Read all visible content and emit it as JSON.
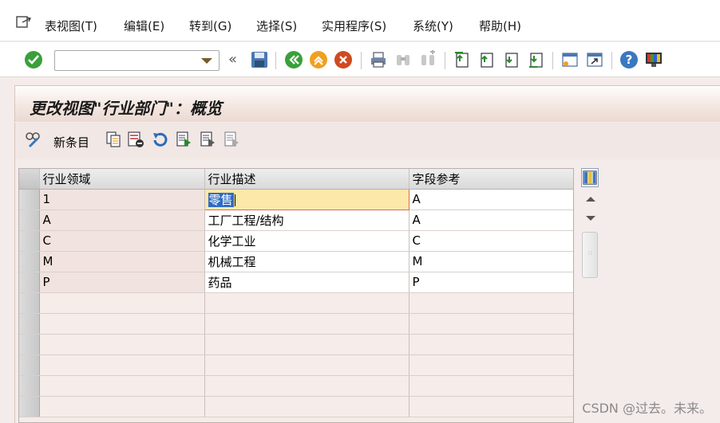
{
  "menu": {
    "items": [
      "表视图(T)",
      "编辑(E)",
      "转到(G)",
      "选择(S)",
      "实用程序(S)",
      "系统(Y)",
      "帮助(H)"
    ]
  },
  "toolbar": {
    "command_field_value": "",
    "icons": [
      "enter-icon",
      "history-icon",
      "save-icon",
      "back-icon",
      "exit-icon",
      "cancel-icon",
      "print-icon",
      "find-icon",
      "find-next-icon",
      "first-page-icon",
      "previous-page-icon",
      "next-page-icon",
      "last-page-icon",
      "new-session-icon",
      "shortcut-icon",
      "help-icon",
      "layout-menu-icon"
    ]
  },
  "title": "更改视图\"行业部门\"：概览",
  "app_toolbar": {
    "new_entries_label": "新条目"
  },
  "table": {
    "columns": [
      "行业领域",
      "行业描述",
      "字段参考"
    ],
    "rows": [
      [
        "1",
        "零售",
        "A"
      ],
      [
        "A",
        "工厂工程/结构",
        "A"
      ],
      [
        "C",
        "化学工业",
        "C"
      ],
      [
        "M",
        "机械工程",
        "M"
      ],
      [
        "P",
        "药品",
        "P"
      ]
    ],
    "empty_rows": 6
  },
  "watermark": "CSDN @过去。未来。",
  "colors": {
    "accent_green": "#3aa03a",
    "title_bg": "#f3e5df",
    "focus_bg": "#fce8a8",
    "selection_blue": "#2f6bc6"
  }
}
